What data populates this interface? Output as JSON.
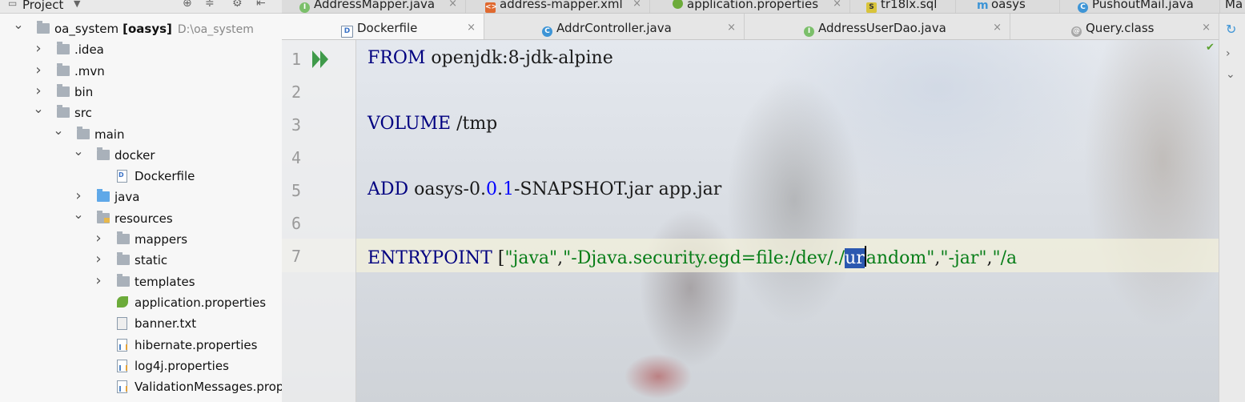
{
  "sidebar": {
    "title": "Project",
    "tree": [
      {
        "label": "oa_system",
        "bold": "[oasys]",
        "path": "D:\\oa_system",
        "level": 0,
        "expanded": true,
        "icon": "folder"
      },
      {
        "label": ".idea",
        "level": 1,
        "expanded": false,
        "icon": "folder"
      },
      {
        "label": ".mvn",
        "level": 1,
        "expanded": false,
        "icon": "folder"
      },
      {
        "label": "bin",
        "level": 1,
        "expanded": false,
        "icon": "folder"
      },
      {
        "label": "src",
        "level": 1,
        "expanded": true,
        "icon": "folder"
      },
      {
        "label": "main",
        "level": 2,
        "expanded": true,
        "icon": "folder"
      },
      {
        "label": "docker",
        "level": 3,
        "expanded": true,
        "icon": "folder"
      },
      {
        "label": "Dockerfile",
        "level": 4,
        "icon": "docker-file"
      },
      {
        "label": "java",
        "level": 3,
        "expanded": false,
        "icon": "folder-blue"
      },
      {
        "label": "resources",
        "level": 3,
        "expanded": true,
        "icon": "folder-resources"
      },
      {
        "label": "mappers",
        "level": 4,
        "expanded": false,
        "icon": "folder"
      },
      {
        "label": "static",
        "level": 4,
        "expanded": false,
        "icon": "folder"
      },
      {
        "label": "templates",
        "level": 4,
        "expanded": false,
        "icon": "folder"
      },
      {
        "label": "application.properties",
        "level": 4,
        "icon": "spring-file"
      },
      {
        "label": "banner.txt",
        "level": 4,
        "icon": "text-file"
      },
      {
        "label": "hibernate.properties",
        "level": 4,
        "icon": "properties-file"
      },
      {
        "label": "log4j.properties",
        "level": 4,
        "icon": "properties-file"
      },
      {
        "label": "ValidationMessages.properti",
        "level": 4,
        "icon": "properties-file"
      }
    ]
  },
  "tabs_row1": [
    {
      "label": "AddressMapper.java",
      "icon": "interface-icon"
    },
    {
      "label": "address-mapper.xml",
      "icon": "xml-icon"
    },
    {
      "label": "application.properties",
      "icon": "spring-icon"
    },
    {
      "label": "tr18lx.sql",
      "icon": "sql-icon"
    },
    {
      "label": "oasys",
      "icon": "maven-icon"
    },
    {
      "label": "PushoutMail.java",
      "icon": "class-icon"
    },
    {
      "label": "Ma",
      "icon": ""
    }
  ],
  "tabs_row2": [
    {
      "label": "Dockerfile",
      "icon": "docker-icon",
      "active": true
    },
    {
      "label": "AddrController.java",
      "icon": "class-icon"
    },
    {
      "label": "AddressUserDao.java",
      "icon": "interface-icon"
    },
    {
      "label": "Query.class",
      "icon": "annotation-icon"
    }
  ],
  "editor": {
    "line_numbers": [
      "1",
      "2",
      "3",
      "4",
      "5",
      "6",
      "7"
    ],
    "line1": {
      "kw": "FROM",
      "rest": " openjdk:8-jdk-alpine"
    },
    "line3": {
      "kw": "VOLUME",
      "rest": " /tmp"
    },
    "line5": {
      "kw": "ADD",
      "pre": " oasys-0.",
      "n1": "0",
      "mid": ".",
      "n2": "1",
      "post": "-SNAPSHOT.jar app.jar"
    },
    "line7": {
      "kw": "ENTRYPOINT",
      "open": " [",
      "s1": "\"java\"",
      "c1": ",",
      "s2a": "\"-Djava.security.egd=file:/dev/./",
      "sel": "ur",
      "s2b": "andom\"",
      "c2": ",",
      "s3": "\"-jar\"",
      "c3": ",",
      "s4": "\"/a"
    }
  },
  "colors": {
    "keyword": "#000080",
    "string": "#067d17",
    "number": "#0000ff",
    "selection": "#2b58b0"
  }
}
